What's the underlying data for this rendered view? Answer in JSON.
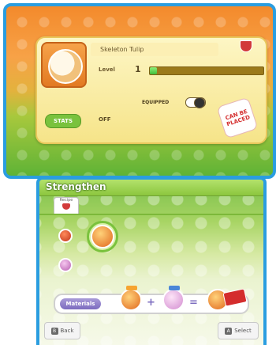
{
  "top_screen": {
    "item_name": "Skeleton Tulip",
    "sell_tag": "",
    "level_label": "Level",
    "level_value": "1",
    "level_progress_percent": 6,
    "equipped_label": "EQUIPPED",
    "equipped": true,
    "stats_label": "STATS",
    "stats_value": "OFF",
    "placed_badge": "CAN BE PLACED"
  },
  "bottom_screen": {
    "title": "Strengthen",
    "tab_label": "Recipe",
    "materials_label": "Materials",
    "plus": "+",
    "equals": "=",
    "back_label": "Back",
    "select_label": "Select",
    "back_button_glyph": "B",
    "select_button_glyph": "A"
  },
  "colors": {
    "frame": "#2a9de0",
    "title_bar": "#8cc63e",
    "level_fill": "#3fbe3a",
    "placed_badge": "#d42d2d"
  },
  "icons": [
    "flower-item-icon",
    "sell-cup-icon",
    "red-material-icon",
    "orange-material-icon",
    "pink-material-icon",
    "new-badge-icon"
  ]
}
